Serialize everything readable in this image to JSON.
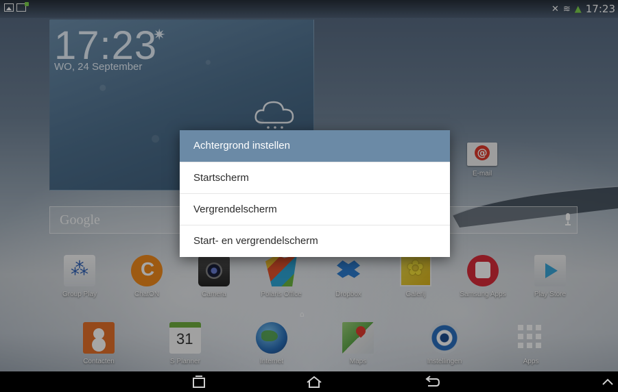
{
  "status_bar": {
    "time": "17:23",
    "left_icons": [
      "picture-icon",
      "screen-mirror-icon"
    ],
    "right_icons": [
      "mute-icon",
      "wifi-icon",
      "download-icon"
    ]
  },
  "clock_widget": {
    "time": "17:23",
    "date": "WO, 24 September",
    "weather_icon": "cloud-icon"
  },
  "search": {
    "label": "Google",
    "icon": "mic-icon"
  },
  "email_app": {
    "label": "E-mail"
  },
  "apps_row1": [
    {
      "label": "Group Play",
      "icon": "group-play-icon"
    },
    {
      "label": "ChatON",
      "icon": "chaton-icon"
    },
    {
      "label": "Camera",
      "icon": "camera-icon"
    },
    {
      "label": "Polaris Office",
      "icon": "polaris-office-icon"
    },
    {
      "label": "Dropbox",
      "icon": "dropbox-icon"
    },
    {
      "label": "Galerij",
      "icon": "gallery-icon"
    },
    {
      "label": "Samsung Apps",
      "icon": "samsung-apps-icon"
    },
    {
      "label": "Play Store",
      "icon": "play-store-icon"
    }
  ],
  "apps_row2": [
    {
      "label": "Contacten",
      "icon": "contacts-icon"
    },
    {
      "label": "S Planner",
      "icon": "calendar-icon"
    },
    {
      "label": "Internet",
      "icon": "globe-icon"
    },
    {
      "label": "Maps",
      "icon": "maps-icon"
    },
    {
      "label": "Instellingen",
      "icon": "settings-icon"
    },
    {
      "label": "Apps",
      "icon": "apps-grid-icon"
    }
  ],
  "splanner_day": "31",
  "dialog": {
    "title": "Achtergrond instellen",
    "options": [
      "Startscherm",
      "Vergrendelscherm",
      "Start- en vergrendelscherm"
    ]
  },
  "colors": {
    "dialog_header": "#6b8aa6",
    "dialog_bg": "#ffffff"
  }
}
